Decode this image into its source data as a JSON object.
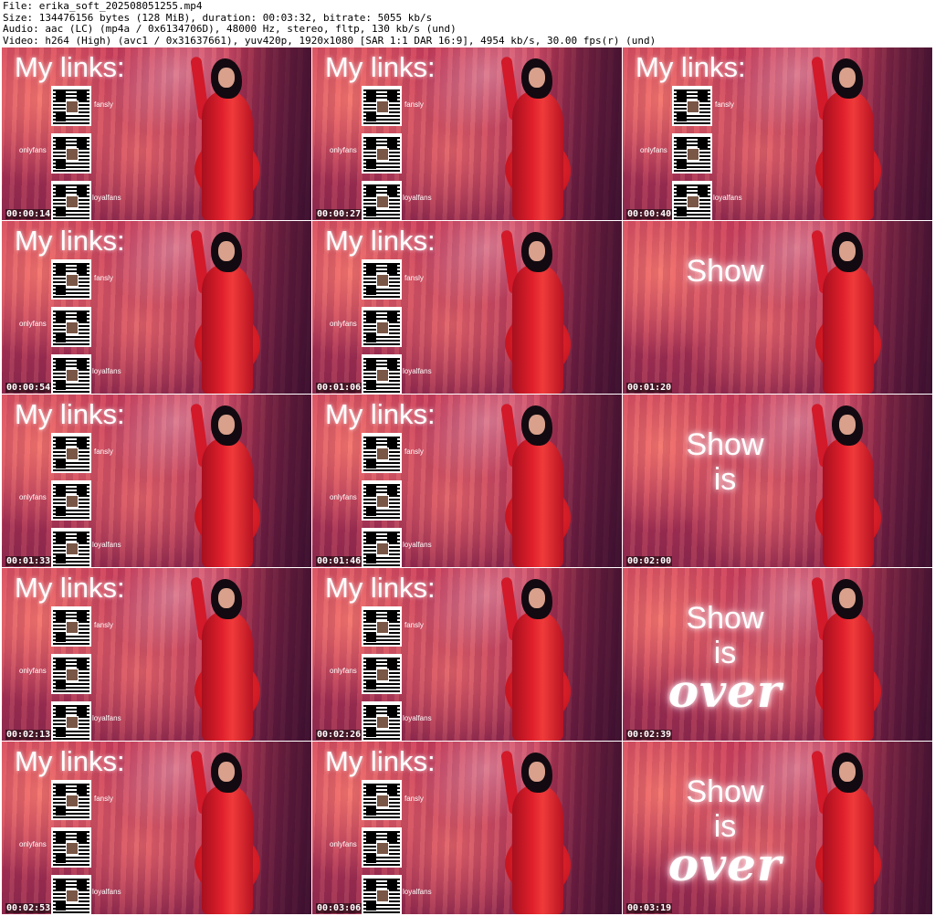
{
  "header": {
    "file_line": "File: erika_soft_202508051255.mp4",
    "size_line": "Size: 134476156 bytes (128 MiB), duration: 00:03:32, bitrate: 5055 kb/s",
    "audio_line": "Audio: aac (LC) (mp4a / 0x6134706D), 48000 Hz, stereo, fltp, 130 kb/s (und)",
    "video_line": "Video: h264 (High) (avc1 / 0x31637661), yuv420p, 1920x1080 [SAR 1:1 DAR 16:9], 4954 kb/s, 30.00 fps(r) (und)"
  },
  "overlay_text": {
    "links_title": "My links:",
    "fansly": "fansly",
    "onlyfans": "onlyfans",
    "loyalfans": "loyalfans",
    "show": "Show",
    "is": "is",
    "over": "over"
  },
  "thumbnails": [
    {
      "time": "00:00:14",
      "overlay": "links"
    },
    {
      "time": "00:00:27",
      "overlay": "links"
    },
    {
      "time": "00:00:40",
      "overlay": "links"
    },
    {
      "time": "00:00:54",
      "overlay": "links"
    },
    {
      "time": "00:01:06",
      "overlay": "links"
    },
    {
      "time": "00:01:20",
      "overlay": "show"
    },
    {
      "time": "00:01:33",
      "overlay": "links"
    },
    {
      "time": "00:01:46",
      "overlay": "links"
    },
    {
      "time": "00:02:00",
      "overlay": "show_is"
    },
    {
      "time": "00:02:13",
      "overlay": "links"
    },
    {
      "time": "00:02:26",
      "overlay": "links"
    },
    {
      "time": "00:02:39",
      "overlay": "show_is_over"
    },
    {
      "time": "00:02:53",
      "overlay": "links"
    },
    {
      "time": "00:03:06",
      "overlay": "links"
    },
    {
      "time": "00:03:19",
      "overlay": "show_is_over"
    }
  ]
}
